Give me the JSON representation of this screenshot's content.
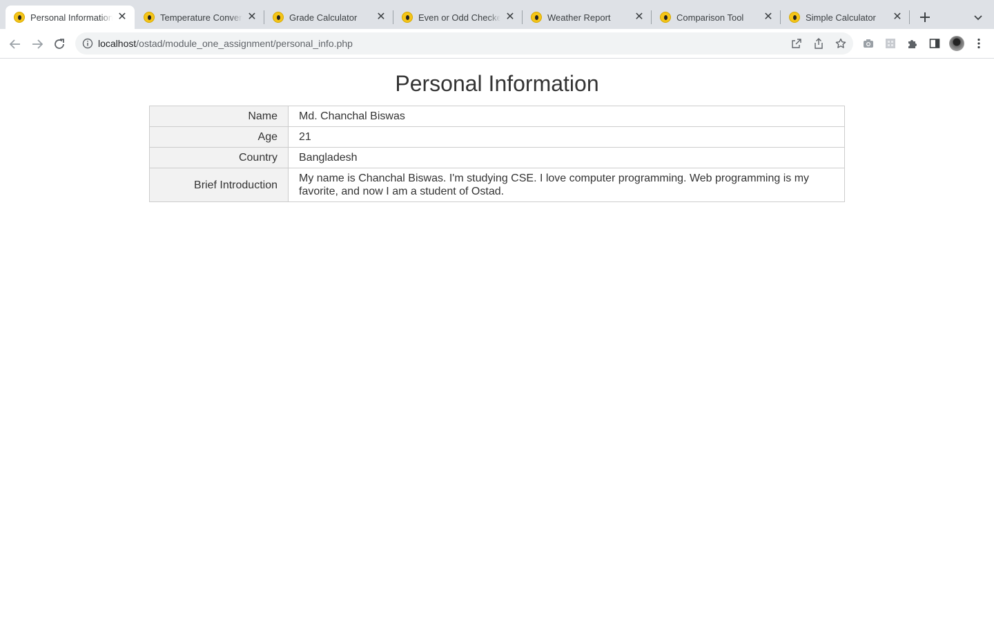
{
  "browser": {
    "tabs": [
      {
        "title": "Personal Information | ",
        "active": true
      },
      {
        "title": "Temperature Converter",
        "active": false
      },
      {
        "title": "Grade Calculator",
        "active": false
      },
      {
        "title": "Even or Odd Checker",
        "active": false
      },
      {
        "title": "Weather Report",
        "active": false
      },
      {
        "title": "Comparison Tool",
        "active": false
      },
      {
        "title": "Simple Calculator",
        "active": false
      }
    ],
    "url_host": "localhost",
    "url_path": "/ostad/module_one_assignment/personal_info.php",
    "favicon_color": "#f5c518"
  },
  "page": {
    "title": "Personal Information",
    "rows": [
      {
        "label": "Name",
        "value": "Md. Chanchal Biswas"
      },
      {
        "label": "Age",
        "value": "21"
      },
      {
        "label": "Country",
        "value": "Bangladesh"
      },
      {
        "label": "Brief Introduction",
        "value": "My name is Chanchal Biswas. I'm studying CSE. I love computer programming. Web programming is my favorite, and now I am a student of Ostad."
      }
    ]
  },
  "colors": {
    "label_bg": "#f2f2f2",
    "border": "#cccccc",
    "text": "#333333"
  }
}
